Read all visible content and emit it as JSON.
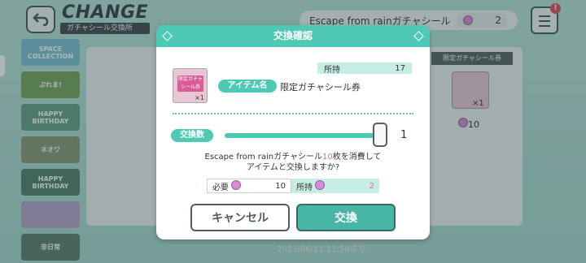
{
  "header": {
    "title": "CHANGE",
    "subtitle": "ガチャシール交換所",
    "currency_label": "Escape from rainガチャシール",
    "currency_value": "2",
    "notification_badge": "!"
  },
  "side_list": [
    {
      "label": "SPACE COLLECTION",
      "color": "#7cc0d8"
    },
    {
      "label": "ぷれま!",
      "color": "#74a35a"
    },
    {
      "label": "HAPPY BIRTHDAY",
      "color": "#62a08c"
    },
    {
      "label": "ネオワ",
      "color": "#8a9a7a"
    },
    {
      "label": "HAPPY BIRTHDAY",
      "color": "#50806a"
    },
    {
      "label": "",
      "color": "#b7a3cc"
    },
    {
      "label": "非日常",
      "color": "#5b7e6a"
    }
  ],
  "background_table": {
    "column_header": "限定ガチャシール券",
    "card_count": "×1",
    "cost": "10",
    "deadline": "2023/06/11 11:59まで"
  },
  "modal": {
    "title": "交換確認",
    "held_label": "所持",
    "held_value": "17",
    "item_thumb_text": "限定ガチャシール券",
    "item_count": "×1",
    "item_name_tag": "アイテム名",
    "item_name": "限定ガチャシール券",
    "quantity_tag": "交換数",
    "quantity_value": "1",
    "slider_fraction": 1.0,
    "message_pre": "Escape from rainガチャシール",
    "message_highlight": "10",
    "message_post": "枚を消費して",
    "message_line2": "アイテムと交換しますか?",
    "required_label": "必要",
    "required_value": "10",
    "owned_label": "所持",
    "owned_value": "2",
    "cancel_label": "キャンセル",
    "ok_label": "交換"
  },
  "colors": {
    "accent": "#4ec9b5",
    "highlight": "#e36ea4",
    "dark": "#3d5c5c"
  }
}
